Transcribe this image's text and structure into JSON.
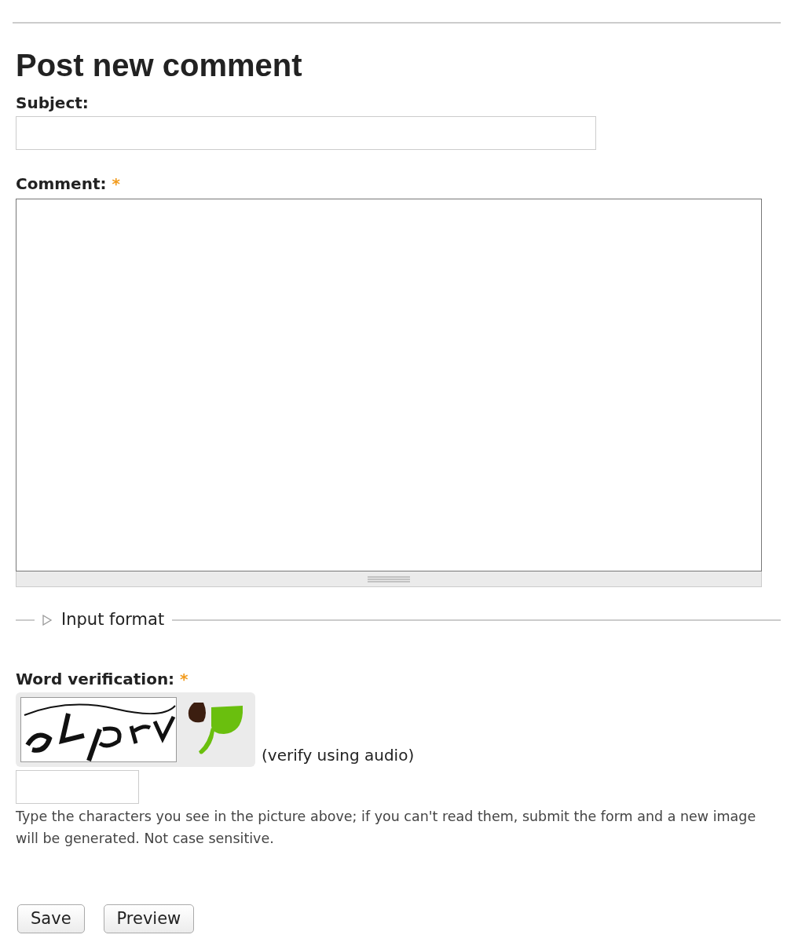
{
  "title": "Post new comment",
  "fields": [
    {
      "kind": "text",
      "label": "Subject:"
    },
    {
      "kind": "textarea",
      "label": "Comment:",
      "required_mark": "*"
    }
  ],
  "fieldset": {
    "legend": "Input format",
    "collapsed": true
  },
  "captcha": {
    "label": "Word verification:",
    "required_mark": "*",
    "audio_link": "(verify using audio)",
    "description": "Type the characters you see in the picture above; if you can't read them, submit the form and a new image will be generated. Not case sensitive."
  },
  "buttons": [
    "Save",
    "Preview"
  ]
}
